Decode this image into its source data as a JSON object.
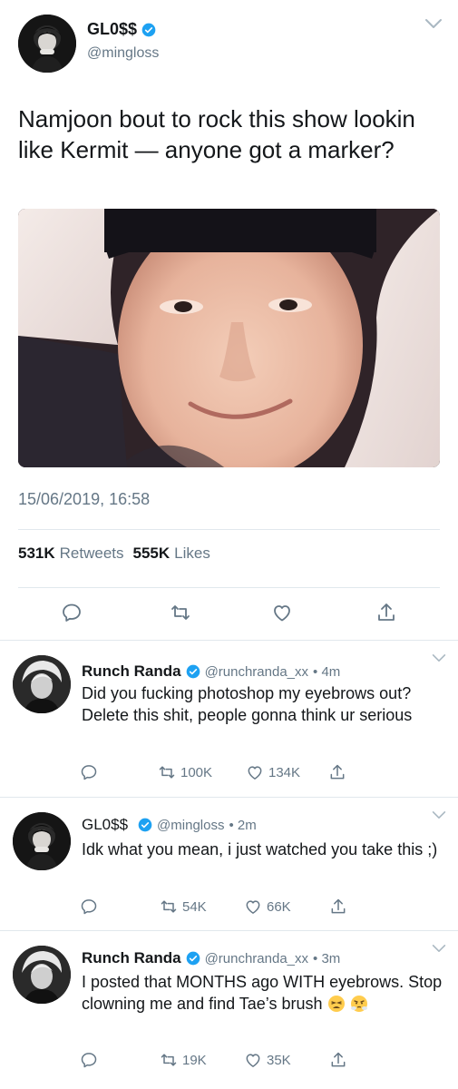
{
  "tweet": {
    "author": {
      "display_name": "GL0$$",
      "handle": "@mingloss",
      "verified": true
    },
    "text": "Namjoon bout to rock this show lookin like Kermit — anyone got a marker?",
    "timestamp": "15/06/2019, 16:58",
    "stats": {
      "retweets_value": "531K",
      "retweets_label": "Retweets",
      "likes_value": "555K",
      "likes_label": "Likes"
    },
    "actions": [
      "reply-icon",
      "retweet-icon",
      "heart-icon",
      "share-icon"
    ]
  },
  "replies": [
    {
      "display_name": "Runch Randa",
      "handle": "@runchranda_xx",
      "time": "• 4m",
      "verified": true,
      "text": "Did you fucking photoshop my eyebrows out? Delete this shit, people gonna think ur serious",
      "retweets": "100K",
      "likes": "134K"
    },
    {
      "display_name": "GL0$$",
      "handle": "@mingloss",
      "time": "• 2m",
      "verified": true,
      "text": "Idk what you mean, i just watched you take this ;)",
      "retweets": "54K",
      "likes": "66K"
    },
    {
      "display_name": "Runch Randa",
      "handle": "@runchranda_xx",
      "time": "• 3m",
      "verified": true,
      "text": "I posted that MONTHS ago WITH eyebrows. Stop clowning me and find Tae’s brush",
      "emojis": [
        "tired-face-emoji",
        "steam-nose-emoji"
      ],
      "retweets": "19K",
      "likes": "35K"
    }
  ],
  "colors": {
    "verified_blue": "#1da1f2",
    "text_primary": "#14171a",
    "text_secondary": "#657786",
    "divider": "#e1e8ed"
  }
}
